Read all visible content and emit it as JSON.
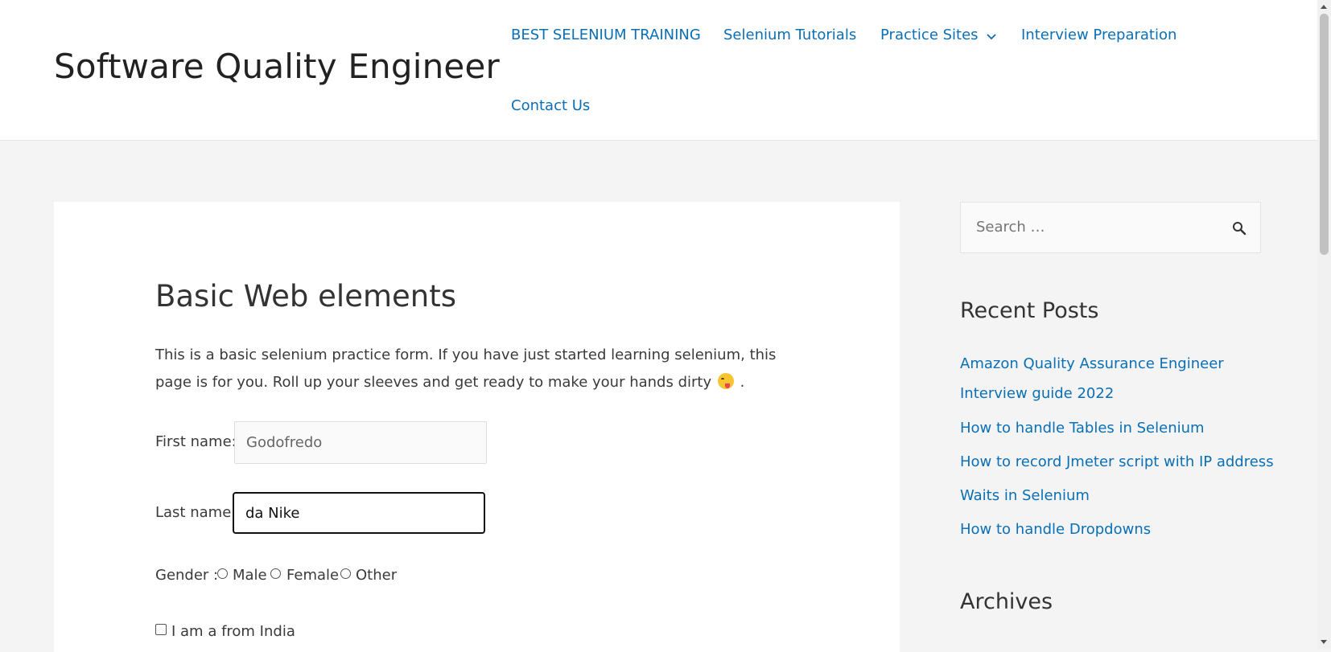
{
  "header": {
    "site_title": "Software Quality Engineer",
    "nav": [
      {
        "label": "BEST SELENIUM TRAINING"
      },
      {
        "label": "Selenium Tutorials"
      },
      {
        "label": "Practice Sites",
        "icon": "chevron-down-icon"
      },
      {
        "label": "Interview Preparation"
      },
      {
        "label": "Contact Us"
      }
    ]
  },
  "main": {
    "title": "Basic Web elements",
    "intro_text": "This is a basic selenium practice form. If you have just started learning selenium, this page is for you. Roll up your sleeves and get ready to make your hands dirty",
    "intro_suffix": " .",
    "intro_icon": "winking-tongue-emoji-icon",
    "form": {
      "first_name_label": "First name:",
      "first_name_value": "Godofredo",
      "last_name_label": "Last name:",
      "last_name_value": "da Nike",
      "gender_label": "Gender :",
      "gender_options": [
        "Male",
        "Female",
        "Other"
      ],
      "india_checkbox_label": "I am a from India"
    }
  },
  "sidebar": {
    "search_placeholder": "Search …",
    "search_icon": "search-icon",
    "recent_posts_title": "Recent Posts",
    "recent_posts": [
      "Amazon Quality Assurance Engineer",
      "Interview guide 2022",
      "How to handle Tables in Selenium",
      "How to record Jmeter script with IP address",
      "Waits in Selenium",
      "How to handle Dropdowns"
    ],
    "archives_title": "Archives"
  },
  "colors": {
    "link": "#0a6fb5",
    "page_background": "#f4f4f4",
    "card_background": "#ffffff"
  }
}
